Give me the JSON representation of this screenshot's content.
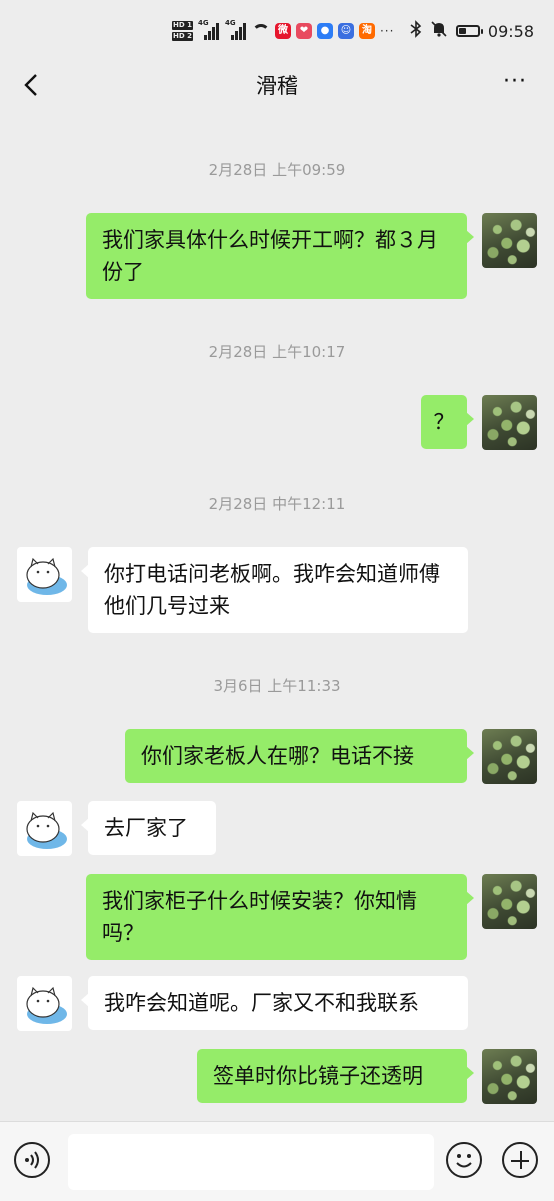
{
  "status_bar": {
    "time": "09:58",
    "hd1": "HD 1",
    "hd2": "HD 2",
    "net1": "4G",
    "net2": "4G",
    "more": "···",
    "battery_percent": 40,
    "icons": [
      "bluetooth-icon",
      "mute-icon",
      "weibo-icon",
      "app-icon",
      "qq-icon",
      "taobao-icon"
    ]
  },
  "nav": {
    "title": "滑稽",
    "more_label": "···"
  },
  "messages": [
    {
      "time": "2月28日 上午09:59"
    },
    {
      "from": "me",
      "text": "我们家具体什么时候开工啊？都３月份了"
    },
    {
      "time": "2月28日 上午10:17"
    },
    {
      "from": "me",
      "text": "？"
    },
    {
      "time": "2月28日 中午12:11"
    },
    {
      "from": "friend",
      "text": "你打电话问老板啊。我咋会知道师傅他们几号过来"
    },
    {
      "time": "3月6日 上午11:33"
    },
    {
      "from": "me",
      "text": "你们家老板人在哪？电话不接"
    },
    {
      "from": "friend",
      "text": "去厂家了"
    },
    {
      "from": "me",
      "text": "我们家柜子什么时候安装？你知情吗？"
    },
    {
      "from": "friend",
      "text": "我咋会知道呢。厂家又不和我联系"
    },
    {
      "from": "me",
      "text": "签单时你比镜子还透明"
    }
  ],
  "input": {
    "placeholder": ""
  },
  "colors": {
    "background": "#ededed",
    "my_bubble": "#95ec69",
    "friend_bubble": "#ffffff",
    "timestamp": "#9a9a9a"
  }
}
